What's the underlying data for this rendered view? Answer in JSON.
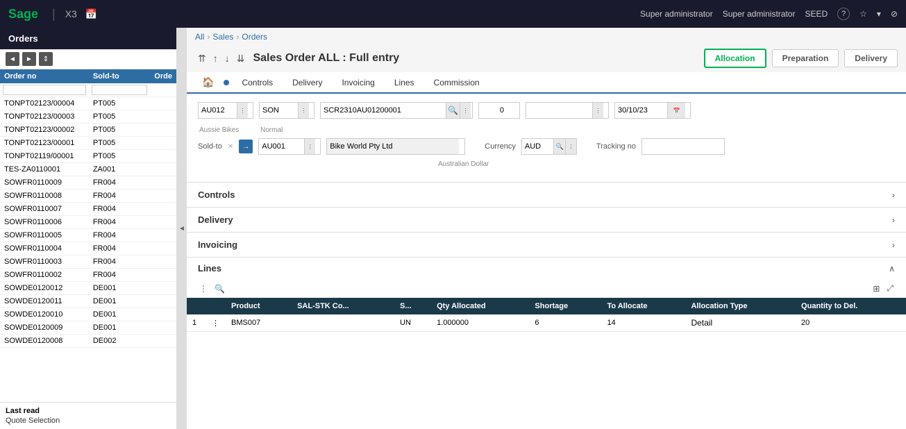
{
  "app": {
    "logo": "Sage",
    "product": "X3",
    "calendar_icon": "📅",
    "user1": "Super administrator",
    "user2": "Super administrator",
    "seed": "SEED",
    "help_icon": "?",
    "star_icon": "★",
    "settings_icon": "⚙",
    "close_icon": "✕"
  },
  "sidebar": {
    "title": "Orders",
    "columns": [
      "Order no",
      "Sold-to",
      "Orde"
    ],
    "toolbar_btns": [
      "◄",
      "►",
      "↕"
    ],
    "rows": [
      [
        "TONPT02123/00004",
        "PT005",
        ""
      ],
      [
        "TONPT02123/00003",
        "PT005",
        ""
      ],
      [
        "TONPT02123/00002",
        "PT005",
        ""
      ],
      [
        "TONPT02123/00001",
        "PT005",
        ""
      ],
      [
        "TONPT02119/00001",
        "PT005",
        ""
      ],
      [
        "TES-ZA0110001",
        "ZA001",
        ""
      ],
      [
        "SOWFR0110009",
        "FR004",
        ""
      ],
      [
        "SOWFR0110008",
        "FR004",
        ""
      ],
      [
        "SOWFR0110007",
        "FR004",
        ""
      ],
      [
        "SOWFR0110006",
        "FR004",
        ""
      ],
      [
        "SOWFR0110005",
        "FR004",
        ""
      ],
      [
        "SOWFR0110004",
        "FR004",
        ""
      ],
      [
        "SOWFR0110003",
        "FR004",
        ""
      ],
      [
        "SOWFR0110002",
        "FR004",
        ""
      ],
      [
        "SOWDE0120012",
        "DE001",
        ""
      ],
      [
        "SOWDE0120011",
        "DE001",
        ""
      ],
      [
        "SOWDE0120010",
        "DE001",
        ""
      ],
      [
        "SOWDE0120009",
        "DE001",
        ""
      ],
      [
        "SOWDE0120008",
        "DE002",
        ""
      ]
    ],
    "last_read": "Last read",
    "quote_selection": "Quote Selection"
  },
  "breadcrumb": {
    "all": "All",
    "sales": "Sales",
    "orders": "Orders",
    "sep": ">"
  },
  "form": {
    "title": "Sales Order ALL : Full entry",
    "actions": {
      "allocation": "Allocation",
      "preparation": "Preparation",
      "delivery": "Delivery"
    },
    "tabs": [
      "Controls",
      "Delivery",
      "Invoicing",
      "Lines",
      "Commission"
    ],
    "fields": {
      "site": "AU012",
      "type": "SON",
      "type_sub": "Normal",
      "site_sub": "Aussie Bikes",
      "reference": "SCR2310AU01200001",
      "number": "0",
      "date": "30/10/23",
      "sold_to_label": "Sold-to",
      "sold_to_code": "AU001",
      "sold_to_name": "Bike World Pty Ltd",
      "currency_label": "Currency",
      "currency_code": "AUD",
      "currency_name": "Australian Dollar",
      "tracking_label": "Tracking no",
      "tracking_value": ""
    }
  },
  "sections": {
    "controls": "Controls",
    "delivery": "Delivery",
    "invoicing": "Invoicing",
    "lines": "Lines"
  },
  "lines_table": {
    "columns": [
      "",
      "",
      "Product",
      "SAL-STK Co...",
      "S...",
      "Qty Allocated",
      "Shortage",
      "To Allocate",
      "Allocation Type",
      "Quantity to Del."
    ],
    "rows": [
      {
        "num": "1",
        "product": "BMS007",
        "sal_stk": "",
        "s": "UN",
        "qty_allocated": "1.000000",
        "shortage": "6",
        "to_allocate": "14",
        "allocation_type": "Detail",
        "qty_to_del": "20"
      }
    ]
  }
}
